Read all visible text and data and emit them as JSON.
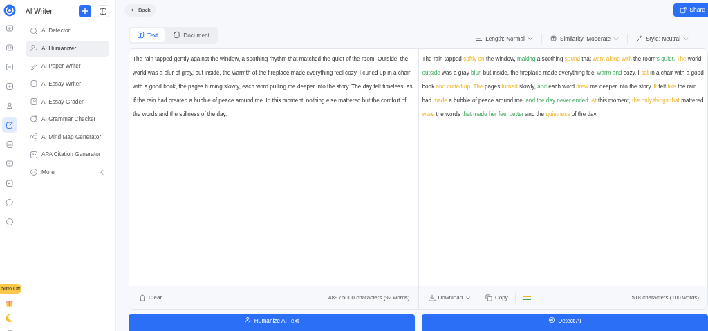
{
  "rail": {
    "promo": "50% Off"
  },
  "sidebar": {
    "title": "AI Writer",
    "items": [
      {
        "label": "AI Detector",
        "selected": false
      },
      {
        "label": "AI Humanizer",
        "selected": true
      },
      {
        "label": "AI Paper Writer",
        "selected": false
      },
      {
        "label": "AI Essay Writer",
        "selected": false
      },
      {
        "label": "AI Essay Grader",
        "selected": false
      },
      {
        "label": "AI Grammar Checker",
        "selected": false
      },
      {
        "label": "AI Mind Map Generator",
        "selected": false
      },
      {
        "label": "APA Citation Generator",
        "selected": false
      },
      {
        "label": "More",
        "selected": false
      }
    ]
  },
  "topbar": {
    "back": "Back",
    "share": "Share"
  },
  "mode_tabs": [
    {
      "label": "Text",
      "selected": true
    },
    {
      "label": "Document",
      "selected": false
    }
  ],
  "options": [
    "Length: Normal",
    "Similarity: Moderate",
    "Style: Neutral"
  ],
  "input": {
    "text": "The rain tapped gently against the window, a soothing rhythm that matched the quiet of the room. Outside, the world was a blur of gray, but inside, the warmth of the fireplace made everything feel cozy. I curled up in a chair with a good book, the pages turning slowly, each word pulling me deeper into the story. The day felt timeless, as if the rain had created a bubble of peace around me. In this moment, nothing else mattered but the comfort of the words and the stillness of the day.",
    "clear": "Clear",
    "count": "489 / 5000 characters (92 words)"
  },
  "output": {
    "segments": [
      {
        "text": "The rain tapped ",
        "kind": "plain"
      },
      {
        "text": "softly on",
        "kind": "changed"
      },
      {
        "text": " the window, ",
        "kind": "plain"
      },
      {
        "text": "making",
        "kind": "rephrased"
      },
      {
        "text": " a soothing ",
        "kind": "plain"
      },
      {
        "text": "sound",
        "kind": "changed"
      },
      {
        "text": " that ",
        "kind": "plain"
      },
      {
        "text": "went along with",
        "kind": "changed"
      },
      {
        "text": " the room",
        "kind": "plain"
      },
      {
        "text": "'s quiet. ",
        "kind": "rephrased"
      },
      {
        "text": "The",
        "kind": "changed"
      },
      {
        "text": " world ",
        "kind": "plain"
      },
      {
        "text": "outside",
        "kind": "rephrased"
      },
      {
        "text": " was a gray ",
        "kind": "plain"
      },
      {
        "text": "blur",
        "kind": "rephrased"
      },
      {
        "text": ", but inside, the fireplace made everything feel ",
        "kind": "plain"
      },
      {
        "text": "warm and",
        "kind": "rephrased"
      },
      {
        "text": " cozy. I ",
        "kind": "plain"
      },
      {
        "text": "sat",
        "kind": "changed"
      },
      {
        "text": " in a chair with a good book ",
        "kind": "plain"
      },
      {
        "text": "and curled up. The",
        "kind": "changed"
      },
      {
        "text": " pages ",
        "kind": "plain"
      },
      {
        "text": "turned",
        "kind": "changed"
      },
      {
        "text": " slowly, ",
        "kind": "plain"
      },
      {
        "text": "and",
        "kind": "rephrased"
      },
      {
        "text": " each word ",
        "kind": "plain"
      },
      {
        "text": "drew",
        "kind": "changed"
      },
      {
        "text": " me deeper into the story. ",
        "kind": "plain"
      },
      {
        "text": "It",
        "kind": "changed"
      },
      {
        "text": " felt ",
        "kind": "plain"
      },
      {
        "text": "like",
        "kind": "changed"
      },
      {
        "text": " the rain had ",
        "kind": "plain"
      },
      {
        "text": "made",
        "kind": "changed"
      },
      {
        "text": " a bubble of peace around me",
        "kind": "plain"
      },
      {
        "text": ", and the day never ended. ",
        "kind": "rephrased"
      },
      {
        "text": "At",
        "kind": "changed"
      },
      {
        "text": " this moment, ",
        "kind": "plain"
      },
      {
        "text": "the only things that",
        "kind": "changed"
      },
      {
        "text": " mattered ",
        "kind": "plain"
      },
      {
        "text": "were",
        "kind": "changed"
      },
      {
        "text": " the words ",
        "kind": "plain"
      },
      {
        "text": "that made her feel better",
        "kind": "rephrased"
      },
      {
        "text": " and the ",
        "kind": "plain"
      },
      {
        "text": "quietness",
        "kind": "changed"
      },
      {
        "text": " of the day.",
        "kind": "plain"
      }
    ],
    "download": "Download",
    "copy": "Copy",
    "count": "518 characters (100 words)"
  },
  "actions": [
    "Humanize AI Text",
    "Detect AI"
  ]
}
